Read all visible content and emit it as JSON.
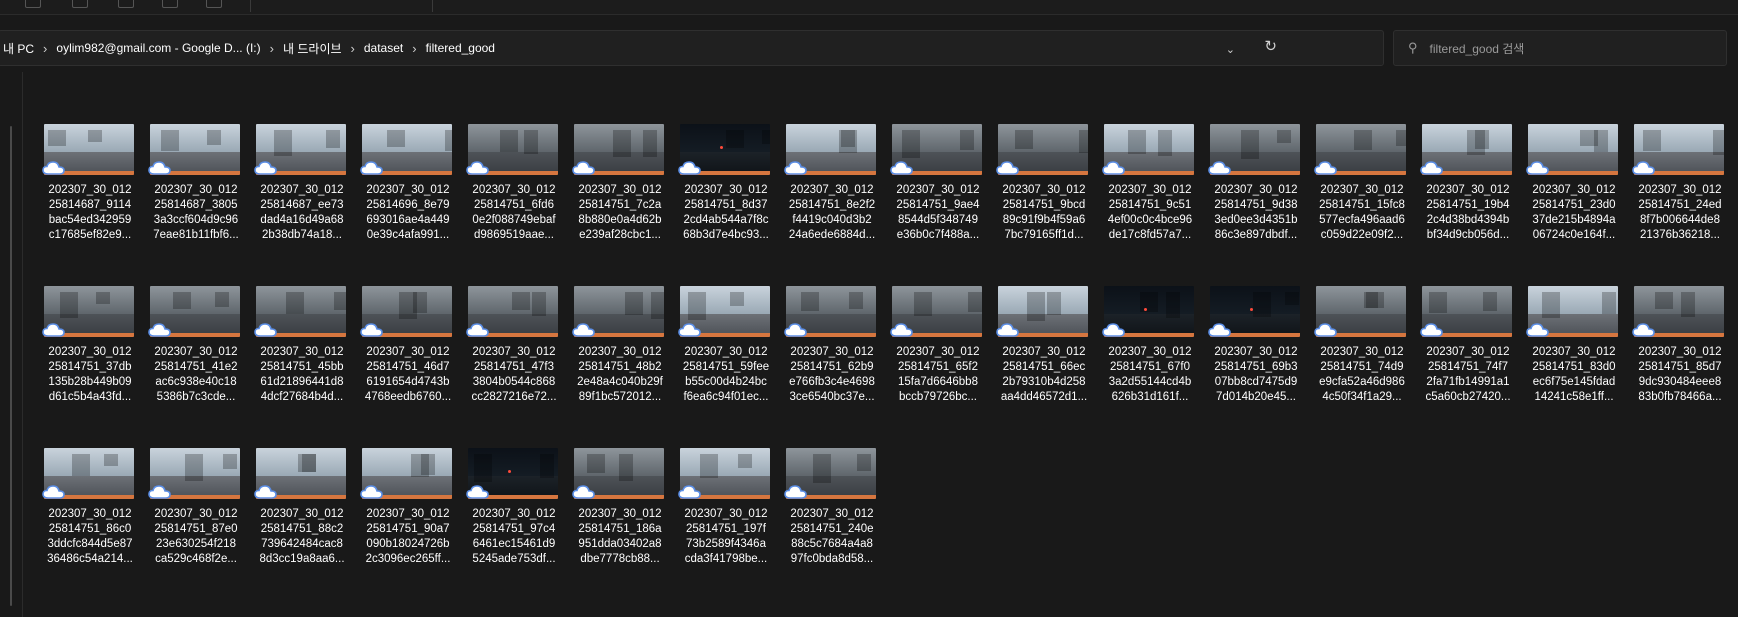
{
  "toolbar": {
    "icons": [
      "cut-icon",
      "copy-icon",
      "paste-icon",
      "rename-icon",
      "share-icon",
      "delete-icon"
    ]
  },
  "address": {
    "crumbs": [
      "내 PC",
      "oylim982@gmail.com - Google D... (I:)",
      "내 드라이브",
      "dataset",
      "filtered_good"
    ],
    "separator": "›"
  },
  "search": {
    "placeholder": "filtered_good 검색"
  },
  "colors": {
    "background": "#191919",
    "bar": "#202020",
    "cloud_stroke": "#5b8ee6",
    "road_band": "#d6763f"
  },
  "files": [
    {
      "name": "202307_30_012\n25814687_9114\nbac54ed342959\nc17685ef82e9...",
      "scene": "day"
    },
    {
      "name": "202307_30_012\n25814687_3805\n3a3ccf604d9c96\n7eae81b11fbf6...",
      "scene": "day"
    },
    {
      "name": "202307_30_012\n25814687_ee73\ndad4a16d49a68\n2b38db74a18...",
      "scene": "day"
    },
    {
      "name": "202307_30_012\n25814696_8e79\n693016ae4a449\n0e39c4afa991...",
      "scene": "day"
    },
    {
      "name": "202307_30_012\n25814751_6fd6\n0e2f088749ebaf\nd9869519aae...",
      "scene": "rain"
    },
    {
      "name": "202307_30_012\n25814751_7c2a\n8b880e0a4d62b\ne239af28cbc1...",
      "scene": "rain"
    },
    {
      "name": "202307_30_012\n25814751_8d37\n2cd4ab544a7f8c\n68b3d7e4bc93...",
      "scene": "night"
    },
    {
      "name": "202307_30_012\n25814751_8e2f2\nf4419c040d3b2\n24a6ede6884d...",
      "scene": "day"
    },
    {
      "name": "202307_30_012\n25814751_9ae4\n8544d5f348749\ne36b0c7f488a...",
      "scene": "rain"
    },
    {
      "name": "202307_30_012\n25814751_9bcd\n89c91f9b4f59a6\n7bc79165ff1d...",
      "scene": "rain"
    },
    {
      "name": "202307_30_012\n25814751_9c51\n4ef00c0c4bce96\nde17c8fd57a7...",
      "scene": "day"
    },
    {
      "name": "202307_30_012\n25814751_9d38\n3ed0ee3d4351b\n86c3e897dbdf...",
      "scene": "rain"
    },
    {
      "name": "202307_30_012\n25814751_15fc8\n577ecfa496aad6\nc059d22e09f2...",
      "scene": "rain"
    },
    {
      "name": "202307_30_012\n25814751_19b4\n2c4d38bd4394b\nbf34d9cb056d...",
      "scene": "day"
    },
    {
      "name": "202307_30_012\n25814751_23d0\n37de215b4894a\n06724c0e164f...",
      "scene": "day"
    },
    {
      "name": "202307_30_012\n25814751_24ed\n8f7b006644de8\n21376b36218...",
      "scene": "day"
    },
    {
      "name": "202307_30_012\n25814751_37db\n135b28b449b09\nd61c5b4a43fd...",
      "scene": "rain"
    },
    {
      "name": "202307_30_012\n25814751_41e2\nac6c938e40c18\n5386b7c3cde...",
      "scene": "rain"
    },
    {
      "name": "202307_30_012\n25814751_45bb\n61d21896441d8\n4dcf27684b4d...",
      "scene": "rain"
    },
    {
      "name": "202307_30_012\n25814751_46d7\n6191654d4743b\n4768eedb6760...",
      "scene": "rain"
    },
    {
      "name": "202307_30_012\n25814751_47f3\n3804b0544c868\ncc2827216e72...",
      "scene": "rain"
    },
    {
      "name": "202307_30_012\n25814751_48b2\n2e48a4c040b29f\n89f1bc572012...",
      "scene": "rain"
    },
    {
      "name": "202307_30_012\n25814751_59fee\nb55c00d4b24bc\nf6ea6c94f01ec...",
      "scene": "day"
    },
    {
      "name": "202307_30_012\n25814751_62b9\ne766fb3c4e4698\n3ce6540bc37e...",
      "scene": "rain"
    },
    {
      "name": "202307_30_012\n25814751_65f2\n15fa7d6646bb8\nbccb79726bc...",
      "scene": "rain"
    },
    {
      "name": "202307_30_012\n25814751_66ec\n2b79310b4d258\naa4dd46572d1...",
      "scene": "day"
    },
    {
      "name": "202307_30_012\n25814751_67f0\n3a2d55144cd4b\n626b31d161f...",
      "scene": "night"
    },
    {
      "name": "202307_30_012\n25814751_69b3\n07bb8cd7475d9\n7d014b20e45...",
      "scene": "night"
    },
    {
      "name": "202307_30_012\n25814751_74d9\ne9cfa52a46d986\n4c50f34f1a29...",
      "scene": "rain"
    },
    {
      "name": "202307_30_012\n25814751_74f7\n2fa71fb14991a1\nc5a60cb27420...",
      "scene": "rain"
    },
    {
      "name": "202307_30_012\n25814751_83d0\nec6f75e145fdad\n14241c58e1ff...",
      "scene": "day"
    },
    {
      "name": "202307_30_012\n25814751_85d7\n9dc930484eee8\n83b0fb78466a...",
      "scene": "rain"
    },
    {
      "name": "202307_30_012\n25814751_86c0\n3ddcfc844d5e87\n36486c54a214...",
      "scene": "day"
    },
    {
      "name": "202307_30_012\n25814751_87e0\n23e630254f218\nca529c468f2e...",
      "scene": "day"
    },
    {
      "name": "202307_30_012\n25814751_88c2\n739642484cac8\n8d3cc19a8aa6...",
      "scene": "day"
    },
    {
      "name": "202307_30_012\n25814751_90a7\n090b18024726b\n2c3096ec265ff...",
      "scene": "day"
    },
    {
      "name": "202307_30_012\n25814751_97c4\n6461ec15461d9\n5245ade753df...",
      "scene": "night"
    },
    {
      "name": "202307_30_012\n25814751_186a\n951dda03402a8\ndbe7778cb88...",
      "scene": "rain"
    },
    {
      "name": "202307_30_012\n25814751_197f\n73b2589f4346a\ncda3f41798be...",
      "scene": "day"
    },
    {
      "name": "202307_30_012\n25814751_240e\n88c5c7684a4a8\n97fc0bda8d58...",
      "scene": "rain"
    }
  ]
}
